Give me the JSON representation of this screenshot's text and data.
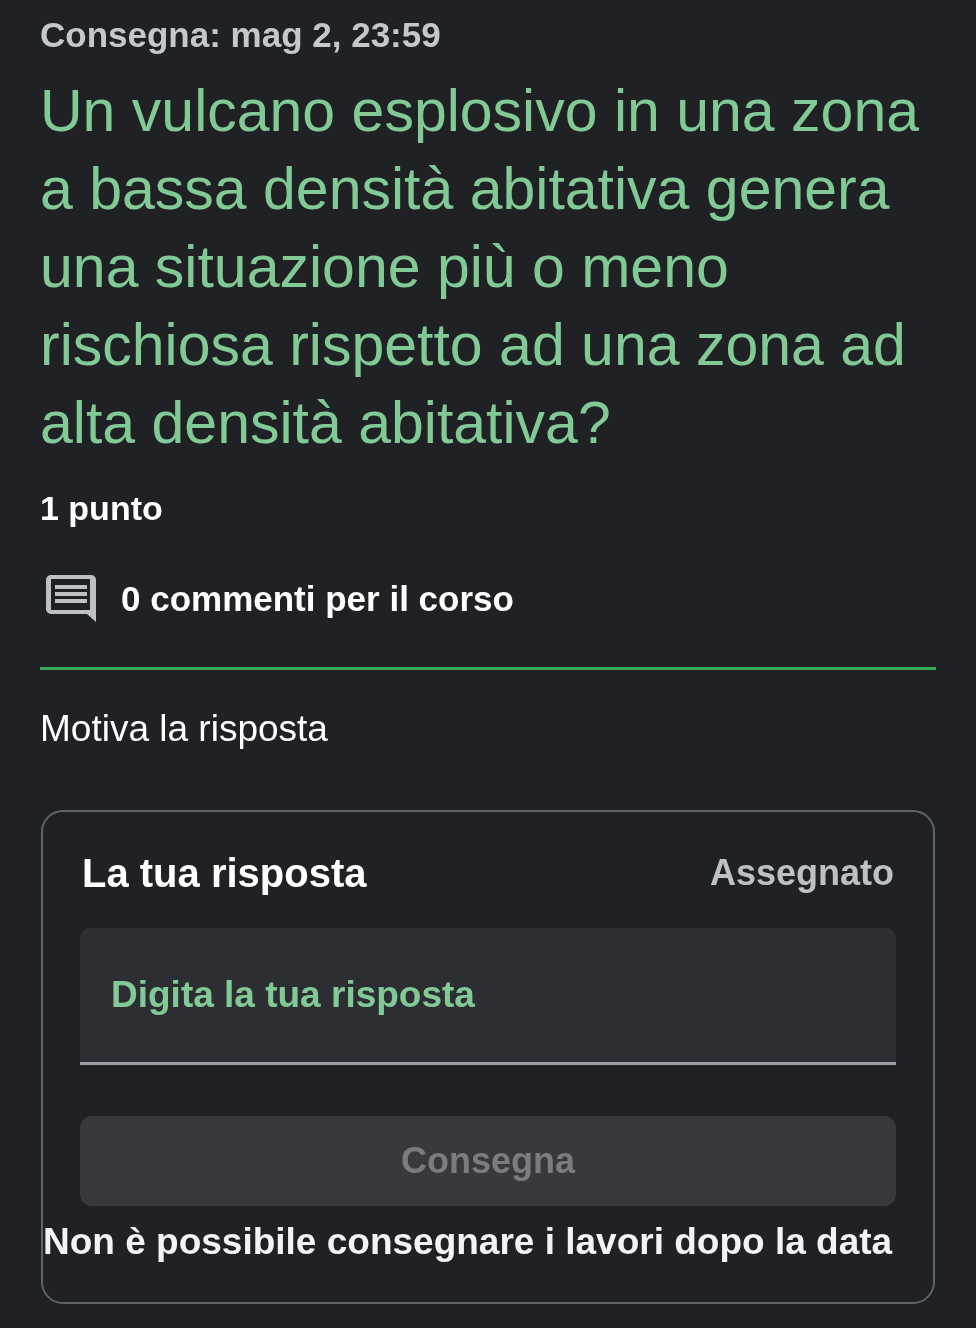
{
  "due": "Consegna: mag 2, 23:59",
  "question": "Un vulcano esplosivo in una zona a bassa densità abitativa genera una situazione più o meno rischiosa rispetto ad una zona ad alta densità abitativa?",
  "points": "1 punto",
  "comments": {
    "label": "0 commenti per il corso"
  },
  "section_label": "Motiva la risposta",
  "answer_card": {
    "title": "La tua risposta",
    "status": "Assegnato",
    "answer_field": {
      "placeholder": "Digita la tua risposta"
    },
    "submit_button": {
      "label": "Consegna",
      "disabled": true
    },
    "notice": "Non è possibile consegnare i lavori dopo la data"
  }
}
